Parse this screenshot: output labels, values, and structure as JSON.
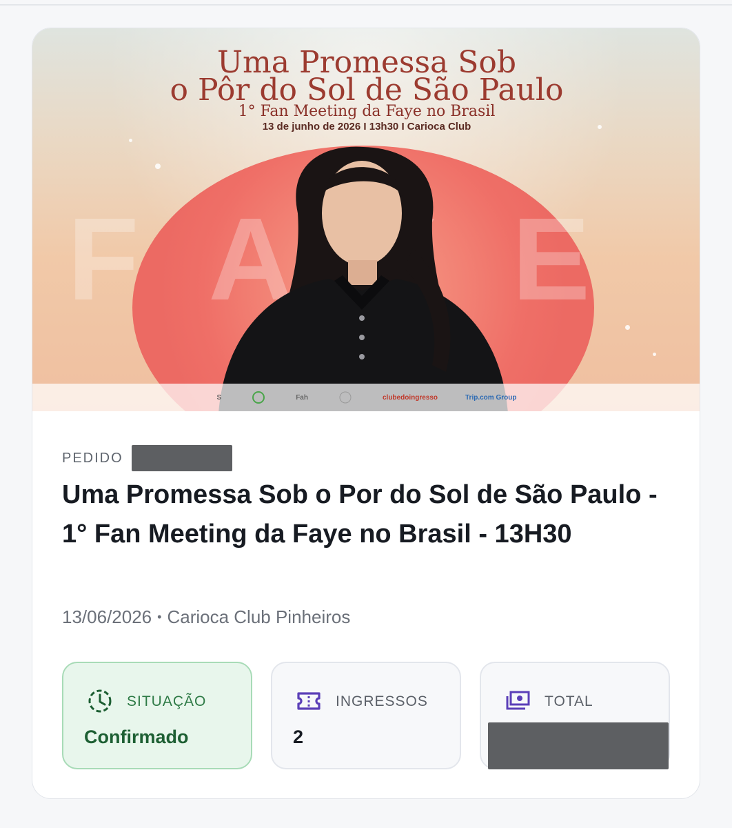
{
  "banner": {
    "poster_title_line1": "Uma Promessa Sob",
    "poster_title_line2": "o Pôr do Sol de São Paulo",
    "poster_subtitle": "1° Fan Meeting da Faye no Brasil",
    "poster_info": "13 de junho de 2026  I  13h30  I  Carioca Club",
    "poster_big_word": "FAYE",
    "sponsors": [
      "S",
      "",
      "Fah",
      "",
      "clubedoingresso",
      "Trip.com Group"
    ]
  },
  "order": {
    "label": "PEDIDO",
    "title": "Uma Promessa Sob o Por do Sol de São Paulo - 1° Fan Meeting da Faye no Brasil - 13H30",
    "date": "13/06/2026",
    "separator": "•",
    "venue": "Carioca Club Pinheiros"
  },
  "tiles": {
    "status": {
      "label": "SITUAÇÃO",
      "value": "Confirmado",
      "icon": "clock-icon"
    },
    "tickets": {
      "label": "INGRESSOS",
      "value": "2",
      "icon": "ticket-icon"
    },
    "total": {
      "label": "TOTAL",
      "icon": "money-icon"
    }
  },
  "colors": {
    "status_green": "#1d5f33",
    "accent_purple": "#5b3fb8",
    "title_text": "#171b22",
    "muted_text": "#6b7079"
  }
}
